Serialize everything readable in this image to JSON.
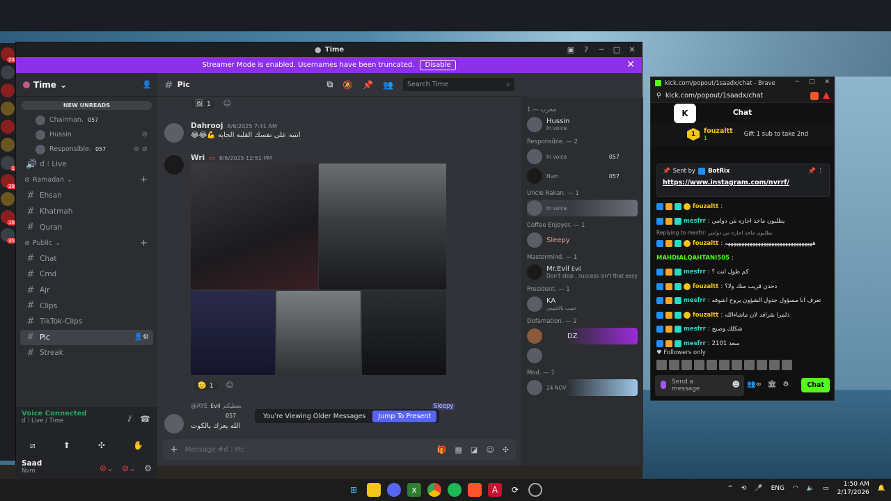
{
  "discord": {
    "window_title": "Time",
    "streamer_banner": "Streamer Mode is enabled. Usernames have been truncated.",
    "disable_label": "Disable",
    "server_name": "Time",
    "new_unreads": "NEW UNREADS",
    "live_top": "ɗ ⁝ Live",
    "voice_users": [
      {
        "name": "Chairman.",
        "tag": "057"
      },
      {
        "name": "Hussin",
        "tag": ""
      },
      {
        "name": "Responsible.",
        "tag": "057"
      }
    ],
    "live_channel": "ɗ ⁝ Live",
    "category_ramadan": "Ramadan",
    "ramadan_channels": [
      "Ehsan",
      "Khatmah",
      "Quran"
    ],
    "category_public": "Public",
    "public_channels": [
      "Chat",
      "Cmd",
      "Ajr",
      "Clips",
      "TikTok-Clips",
      "Pic",
      "Streak"
    ],
    "voice_connected": "Voice Connected",
    "voice_sub": "ɗ ⁝ Live / Time",
    "username": "Saad",
    "user_status": "Nvm",
    "channel_header": "Pic",
    "search_placeholder": "Search Time",
    "messages": {
      "top_reaction": "1",
      "m1_author": "Dahrooj",
      "m1_time": "8/6/2025 7:41 AM",
      "m1_text": "😂😂💪 انتبه على نفسك القلبه الجايه",
      "m2_author": "Wri",
      "m2_time": "8/6/2025 12:51 PM",
      "m2_reaction": "1",
      "m3_author": "@AYE",
      "m3_tag": "Evil",
      "m3_reply": "يعطيكم",
      "m3_tag2": "057",
      "m3_text": "الله يعزك يالكوت",
      "reply_mention": "Sleepy"
    },
    "older_notice": "You're Viewing Older Messages",
    "jump_label": "Jump To Present",
    "composer_placeholder": "Message #ɗ ⁝ Pic",
    "members": {
      "g1": "محرب — 1",
      "g1_members": [
        {
          "name": "Hussin",
          "status": "In voice"
        }
      ],
      "g2": "Responsible. — 2",
      "g2_members": [
        {
          "name": "",
          "status": "In voice",
          "tag": "057"
        },
        {
          "name": "",
          "status": "Nvm",
          "tag": "057"
        }
      ],
      "g3": "Uncle Rakan. — 1",
      "g3_members": [
        {
          "name": "",
          "status": "In voice"
        }
      ],
      "g4": "Coffee Enjoyer. — 1",
      "g4_members": [
        {
          "name": "Sleepy",
          "status": ""
        }
      ],
      "g5": "Mastermind. — 1",
      "g5_members": [
        {
          "name": "Mr.Evil",
          "tag": "Evil",
          "status": "Don't stop , success isn't that easy"
        }
      ],
      "g6": "President. — 1",
      "g6_members": [
        {
          "name": "KA",
          "status": "حبيب يالحبيبي"
        }
      ],
      "g7": "Defamation. — 2",
      "g7_members": [
        {
          "name": "DZ",
          "status": ""
        },
        {
          "name": "",
          "status": ""
        }
      ],
      "g8": "Mod. — 1",
      "g8_members": [
        {
          "name": "",
          "status": "24 NOV"
        }
      ]
    }
  },
  "kick": {
    "window_title": "kick.com/popout/1saadx/chat - Brave",
    "url": "kick.com/popout/1saadx/chat",
    "chat_title": "Chat",
    "gifter_name": "fouzaltt",
    "gifter_count": "1",
    "gift_text": "Gift 1 sub to take 2nd",
    "pinned_sender": "BotRix",
    "pinned_label": "Sent by",
    "pinned_link": "https://www.instagram.com/nvrrf/",
    "messages": [
      {
        "user": "fouzaltt",
        "cls": "ku1",
        "text": "",
        "badges": 3
      },
      {
        "user": "mesfrr",
        "cls": "ku2",
        "text": "يطلبون ماخذ اجازه من دوامي",
        "badges": 2
      },
      {
        "user": "",
        "cls": "reply",
        "text": "Replying to mesfrr: يطلبون ماخذ اجازه من دوامي",
        "badges": 0
      },
      {
        "user": "fouzaltt",
        "cls": "ku1",
        "text": "ههههههههههههههههههههههههههههههههه",
        "badges": 3
      },
      {
        "user": "MAHDIALQAHTANI505",
        "cls": "ku3",
        "text": "",
        "badges": 0
      },
      {
        "user": "mesfrr",
        "cls": "ku2",
        "text": "كم طول انت ؟",
        "badges": 2
      },
      {
        "user": "fouzaltt",
        "cls": "ku1",
        "text": "دحدن قريب منك ولا؟",
        "badges": 3
      },
      {
        "user": "mesfrr",
        "cls": "ku2",
        "text": "تعرف انا مسؤول جدول الشؤون يروح اشوفه",
        "badges": 2
      },
      {
        "user": "fouzaltt",
        "cls": "ku1",
        "text": "ذلمرا بقراقد لان ماشاءالله",
        "badges": 3
      },
      {
        "user": "mesfrr",
        "cls": "ku2",
        "text": "شكلك وصنج",
        "badges": 2
      },
      {
        "user": "mesfrr",
        "cls": "ku2",
        "text": "2101 سعد",
        "badges": 2
      }
    ],
    "followers_only": "Followers only",
    "input_placeholder": "Send a message",
    "chat_button": "Chat"
  },
  "taskbar": {
    "lang": "ENG",
    "time": "1:50 AM",
    "date": "2/17/2026"
  }
}
